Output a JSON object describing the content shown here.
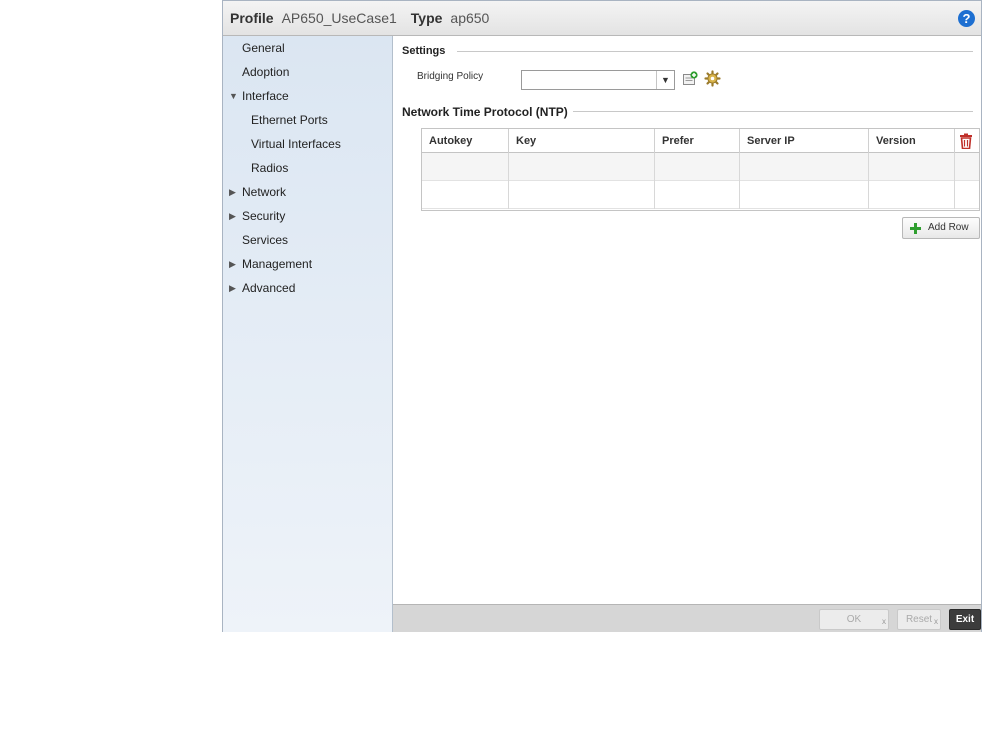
{
  "header": {
    "profile_label": "Profile",
    "profile_value": "AP650_UseCase1",
    "type_label": "Type",
    "type_value": "ap650"
  },
  "sidebar": {
    "items": [
      {
        "label": "General",
        "arrow": ""
      },
      {
        "label": "Adoption",
        "arrow": ""
      },
      {
        "label": "Interface",
        "arrow": "▼"
      },
      {
        "label": "Ethernet Ports",
        "arrow": ""
      },
      {
        "label": "Virtual Interfaces",
        "arrow": ""
      },
      {
        "label": "Radios",
        "arrow": ""
      },
      {
        "label": "Network",
        "arrow": "▶"
      },
      {
        "label": "Security",
        "arrow": "▶"
      },
      {
        "label": "Services",
        "arrow": ""
      },
      {
        "label": "Management",
        "arrow": "▶"
      },
      {
        "label": "Advanced",
        "arrow": "▶"
      }
    ]
  },
  "settings": {
    "title": "Settings",
    "bridging_policy_label": "Bridging Policy",
    "bridging_policy_value": ""
  },
  "ntp": {
    "title": "Network Time Protocol (NTP)",
    "columns": [
      "Autokey",
      "Key",
      "Prefer",
      "Server IP",
      "Version"
    ],
    "add_row_label": "Add Row"
  },
  "footer": {
    "ok_label": "OK",
    "reset_label": "Reset",
    "exit_label": "Exit"
  },
  "colors": {
    "accent": "#1d6fd1",
    "sidebar_bg": "#dbe6f2",
    "delete": "#c0302a",
    "add": "#2f9e2f"
  }
}
